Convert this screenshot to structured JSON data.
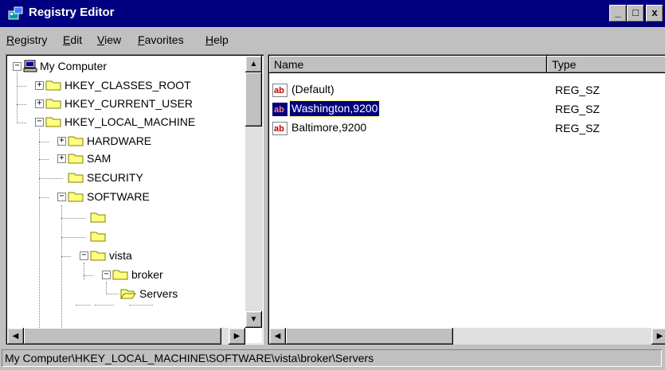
{
  "window": {
    "title": "Registry Editor",
    "minimize": "_",
    "maximize": "□",
    "close": "x"
  },
  "menu": [
    {
      "first": "R",
      "rest": "egistry"
    },
    {
      "first": "E",
      "rest": "dit"
    },
    {
      "first": "V",
      "rest": "iew"
    },
    {
      "first": "F",
      "rest": "avorites"
    },
    {
      "first": "H",
      "rest": "elp"
    }
  ],
  "tree": {
    "root": "My Computer",
    "hkcr": "HKEY_CLASSES_ROOT",
    "hkcu": "HKEY_CURRENT_USER",
    "hklm": "HKEY_LOCAL_MACHINE",
    "hardware": "HARDWARE",
    "sam": "SAM",
    "security": "SECURITY",
    "software": "SOFTWARE",
    "unnamed1": "",
    "unnamed2": "",
    "vista": "vista",
    "broker": "broker",
    "servers": "Servers"
  },
  "list": {
    "columns": {
      "name": "Name",
      "type": "Type"
    },
    "rows": [
      {
        "name": "(Default)",
        "type": "REG_SZ",
        "selected": false
      },
      {
        "name": "Washington,9200",
        "type": "REG_SZ",
        "selected": true
      },
      {
        "name": "Baltimore,9200",
        "type": "REG_SZ",
        "selected": false
      }
    ]
  },
  "status": {
    "path": "My Computer\\HKEY_LOCAL_MACHINE\\SOFTWARE\\vista\\broker\\Servers"
  },
  "colors": {
    "titlebar": "#000080",
    "face": "#c0c0c0",
    "selection": "#000080",
    "folder": "#ffff80"
  }
}
